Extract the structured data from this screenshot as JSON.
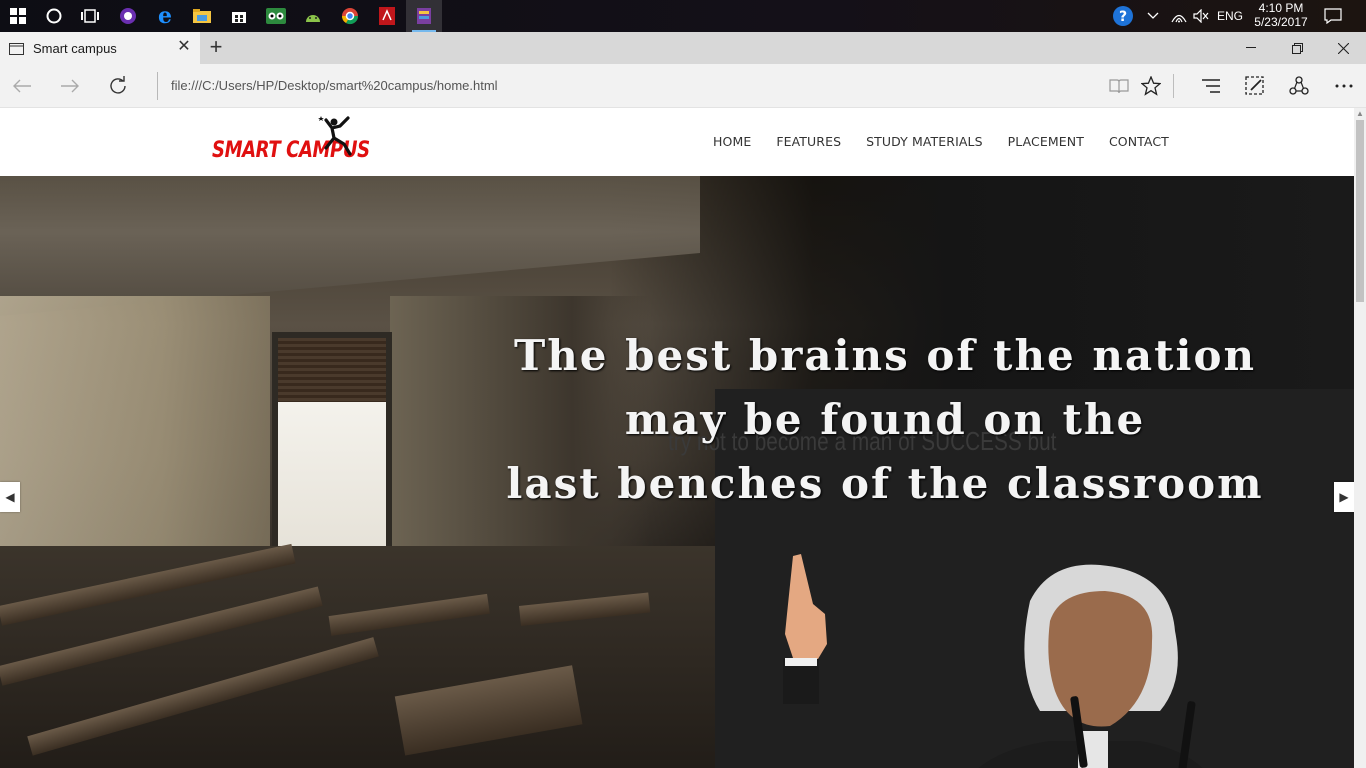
{
  "taskbar": {
    "apps": [
      "start-icon",
      "cortana-icon",
      "task-view-icon",
      "app-purple-icon",
      "edge-icon",
      "file-explorer-icon",
      "store-icon",
      "tripadvisor-icon",
      "android-studio-icon",
      "chrome-icon",
      "acrobat-icon",
      "winrar-icon"
    ],
    "language": "ENG",
    "time": "4:10 PM",
    "date": "5/23/2017"
  },
  "browser": {
    "tab_title": "Smart campus",
    "url": "file:///C:/Users/HP/Desktop/smart%20campus/home.html"
  },
  "site": {
    "logo_text": "SMART CAMPUS",
    "nav": [
      "HOME",
      "FEATURES",
      "STUDY MATERIALS",
      "PLACEMENT",
      "CONTACT"
    ],
    "hero": {
      "quote_line1": "The best brains of the nation",
      "quote_line2": "may be found on the",
      "quote_line3": "last benches of the classroom",
      "board_text": "try not to become a man of SUCCESS but"
    }
  },
  "colors": {
    "logo_red": "#e01010",
    "taskbar": "#0d0d14",
    "chrome_bg": "#f2f2f2"
  }
}
